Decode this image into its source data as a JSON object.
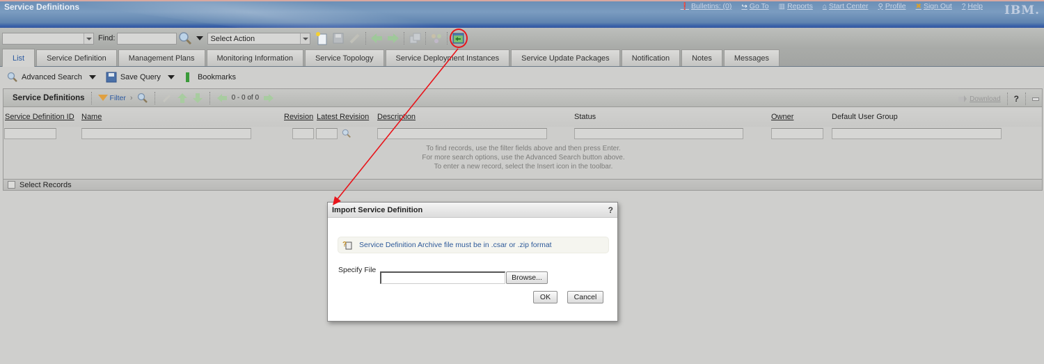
{
  "header": {
    "app_title": "Service Definitions",
    "links": [
      {
        "icon": "bulletins-icon",
        "glyph": "❗",
        "label": "Bulletins: (0)"
      },
      {
        "icon": "goto-icon",
        "glyph": "↪",
        "label": "Go To"
      },
      {
        "icon": "reports-icon",
        "glyph": "▥",
        "label": "Reports"
      },
      {
        "icon": "start-center-icon",
        "glyph": "⌂",
        "label": "Start Center"
      },
      {
        "icon": "profile-icon",
        "glyph": "⚲",
        "label": "Profile"
      },
      {
        "icon": "sign-out-icon",
        "glyph": "✖",
        "label": "Sign Out"
      },
      {
        "icon": "help-icon",
        "glyph": "?",
        "label": "Help"
      }
    ],
    "logo": "IBM."
  },
  "toolbar": {
    "app_select_value": "",
    "find_label": "Find:",
    "find_value": "",
    "select_action": "Select Action",
    "icons": [
      "new-record-icon",
      "save-icon",
      "clear-icon",
      "previous-icon",
      "next-icon",
      "duplicate-icon",
      "workflow-icon",
      "import-icon"
    ]
  },
  "tabs": [
    {
      "label": "List",
      "active": true
    },
    {
      "label": "Service Definition"
    },
    {
      "label": "Management Plans"
    },
    {
      "label": "Monitoring Information"
    },
    {
      "label": "Service Topology"
    },
    {
      "label": "Service Deployment Instances"
    },
    {
      "label": "Service Update Packages"
    },
    {
      "label": "Notification"
    },
    {
      "label": "Notes"
    },
    {
      "label": "Messages"
    }
  ],
  "querybar": {
    "advanced_search": "Advanced Search",
    "save_query": "Save Query",
    "bookmarks": "Bookmarks"
  },
  "table": {
    "title": "Service Definitions",
    "filter_label": "Filter",
    "pager": "0 - 0 of 0",
    "download": "Download",
    "help": "?",
    "columns": [
      {
        "label": "Service Definition ID",
        "underlined": true
      },
      {
        "label": "Name",
        "underlined": true
      },
      {
        "label": "Revision",
        "underlined": true
      },
      {
        "label": "Latest Revision",
        "underlined": true
      },
      {
        "label": "Description",
        "underlined": true
      },
      {
        "label": "Status",
        "underlined": false
      },
      {
        "label": "Owner",
        "underlined": true
      },
      {
        "label": "Default User Group",
        "underlined": false
      }
    ],
    "empty_message": [
      "To find records, use the filter fields above and then press Enter.",
      "For more search options, use the Advanced Search button above.",
      "To enter a new record, select the Insert icon in the toolbar."
    ],
    "select_records": "Select Records"
  },
  "dialog": {
    "title": "Import Service Definition",
    "help": "?",
    "info": "Service Definition Archive file must be in .csar or .zip format",
    "specify_file_label": "Specify File",
    "file_value": "",
    "browse": "Browse...",
    "ok": "OK",
    "cancel": "Cancel"
  },
  "colors": {
    "annotation": "#e8141a",
    "link": "#2b59a0"
  }
}
